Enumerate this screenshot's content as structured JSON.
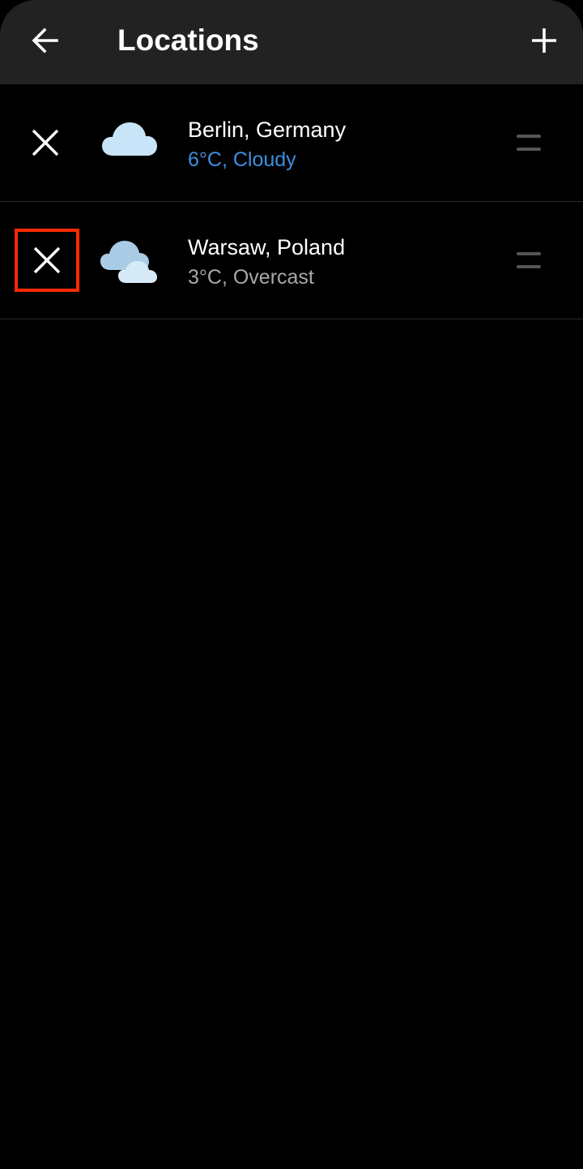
{
  "header": {
    "title": "Locations",
    "back_icon": "arrow-left-icon",
    "add_icon": "plus-icon"
  },
  "locations": [
    {
      "city": "Berlin, Germany",
      "conditions": "6°C, Cloudy",
      "conditions_color": "#3d8fe0",
      "icon": "cloud-icon",
      "remove_icon": "close-icon",
      "drag_icon": "drag-handle-icon"
    },
    {
      "city": "Warsaw, Poland",
      "conditions": "3°C, Overcast",
      "conditions_color": "#a8a8a8",
      "icon": "overcast-clouds-icon",
      "remove_icon": "close-icon",
      "drag_icon": "drag-handle-icon"
    }
  ],
  "colors": {
    "background": "#000000",
    "app_bar": "#222222",
    "highlight": "#ff2a00"
  }
}
